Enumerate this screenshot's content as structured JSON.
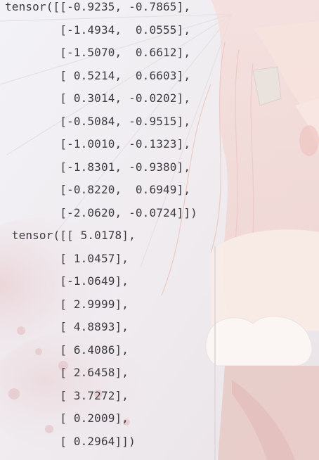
{
  "console": {
    "blocks": [
      {
        "name": "tensor-block-1",
        "lines": [
          "tensor([[-0.9235, -0.7865],",
          "        [-1.4934,  0.0555],",
          "        [-1.5070,  0.6612],",
          "        [ 0.5214,  0.6603],",
          "        [ 0.3014, -0.0202],",
          "        [-0.5084, -0.9515],",
          "        [-1.0010, -0.1323],",
          "        [-1.8301, -0.9380],",
          "        [-0.8220,  0.6949],",
          "        [-2.0620, -0.0724]])"
        ]
      },
      {
        "name": "tensor-block-2",
        "lines": [
          " tensor([[ 5.0178],",
          "        [ 1.0457],",
          "        [-1.0649],",
          "        [ 2.9999],",
          "        [ 4.8893],",
          "        [ 6.4086],",
          "        [ 2.6458],",
          "        [ 3.7272],",
          "        [ 0.2009],",
          "        [ 0.2964]])"
        ]
      }
    ]
  },
  "theme": {
    "text_color": "#3b3b3f",
    "background_color": "#f1eff3",
    "wallpaper_accent": "#f3d9d6"
  }
}
